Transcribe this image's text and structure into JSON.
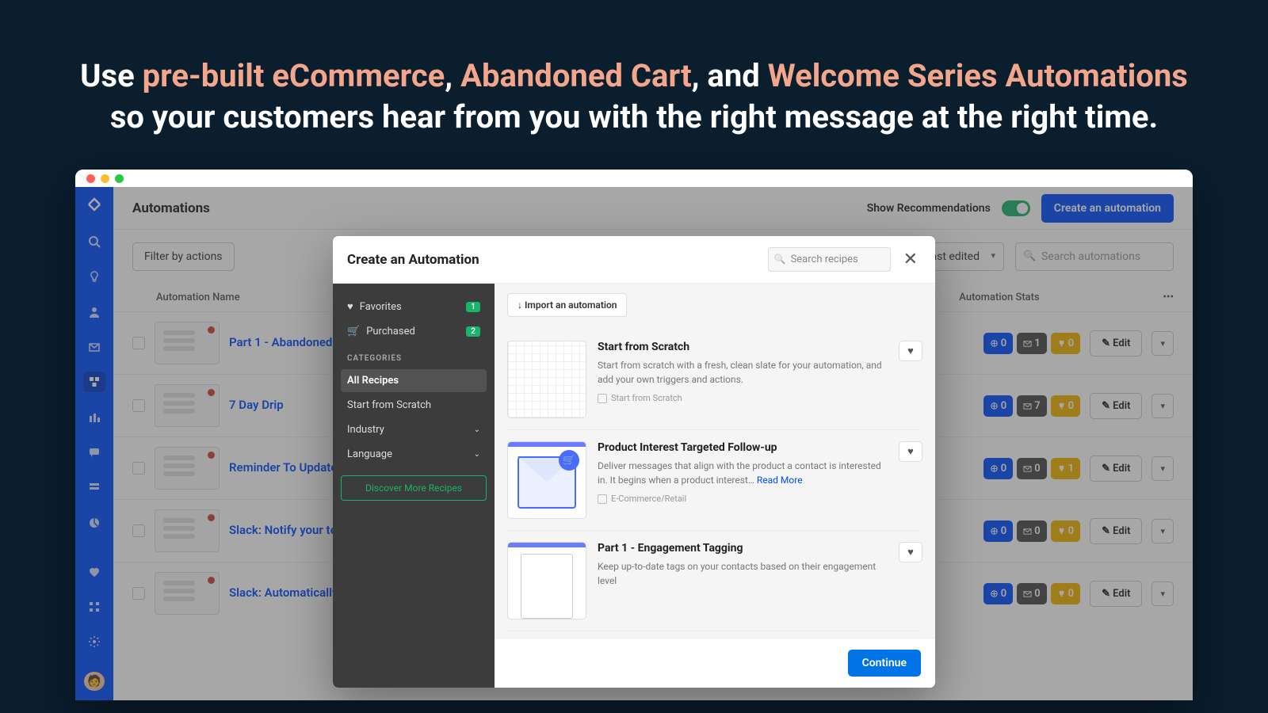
{
  "hero": {
    "line1_pre": "Use ",
    "hl1": "pre-built eCommerce",
    "sep1": ", ",
    "hl2": "Abandoned Cart",
    "sep2": ", and ",
    "hl3": "Welcome Series Automations",
    "line2": "so your customers hear from you with the right message at the right time."
  },
  "topbar": {
    "title": "Automations",
    "recommend_label": "Show Recommendations",
    "create_button": "Create an automation"
  },
  "controls": {
    "filter": "Filter by actions",
    "sort": "Last edited",
    "search_placeholder": "Search automations"
  },
  "table": {
    "col_name": "Automation Name",
    "col_stats": "Automation Stats",
    "dots": "•••",
    "edit_label": "Edit",
    "rows": [
      {
        "name": "Part 1 - Abandoned",
        "s1": "0",
        "s2": "1",
        "s3": "0"
      },
      {
        "name": "7 Day Drip",
        "s1": "0",
        "s2": "7",
        "s3": "0"
      },
      {
        "name": "Reminder To Update",
        "s1": "0",
        "s2": "0",
        "s3": "1"
      },
      {
        "name": "Slack: Notify your te needs help",
        "s1": "0",
        "s2": "0",
        "s3": "0"
      },
      {
        "name": "Slack: Automatically send message when purchase is made  ✨",
        "s1": "0",
        "s2": "0",
        "s3": "0"
      }
    ]
  },
  "modal": {
    "title": "Create an Automation",
    "search_placeholder": "Search recipes",
    "sidebar": {
      "favorites": "Favorites",
      "fav_count": "1",
      "purchased": "Purchased",
      "pur_count": "2",
      "cat_head": "CATEGORIES",
      "all": "All Recipes",
      "scratch": "Start from Scratch",
      "industry": "Industry",
      "language": "Language",
      "discover": "Discover More Recipes"
    },
    "import": "↓ Import an automation",
    "continue": "Continue",
    "recipes": [
      {
        "title": "Start from Scratch",
        "desc": "Start from scratch with a fresh, clean slate for your automation, and add your own triggers and actions.",
        "tag": "Start from Scratch"
      },
      {
        "title": "Product Interest Targeted Follow-up",
        "desc": "Deliver messages that align with the product a contact is interested in. It begins when a product interest… ",
        "read_more": "Read More",
        "tag": "E-Commerce/Retail"
      },
      {
        "title": "Part 1 - Engagement Tagging",
        "desc": "Keep up-to-date tags on your contacts based on their engagement level",
        "tag": ""
      }
    ]
  }
}
